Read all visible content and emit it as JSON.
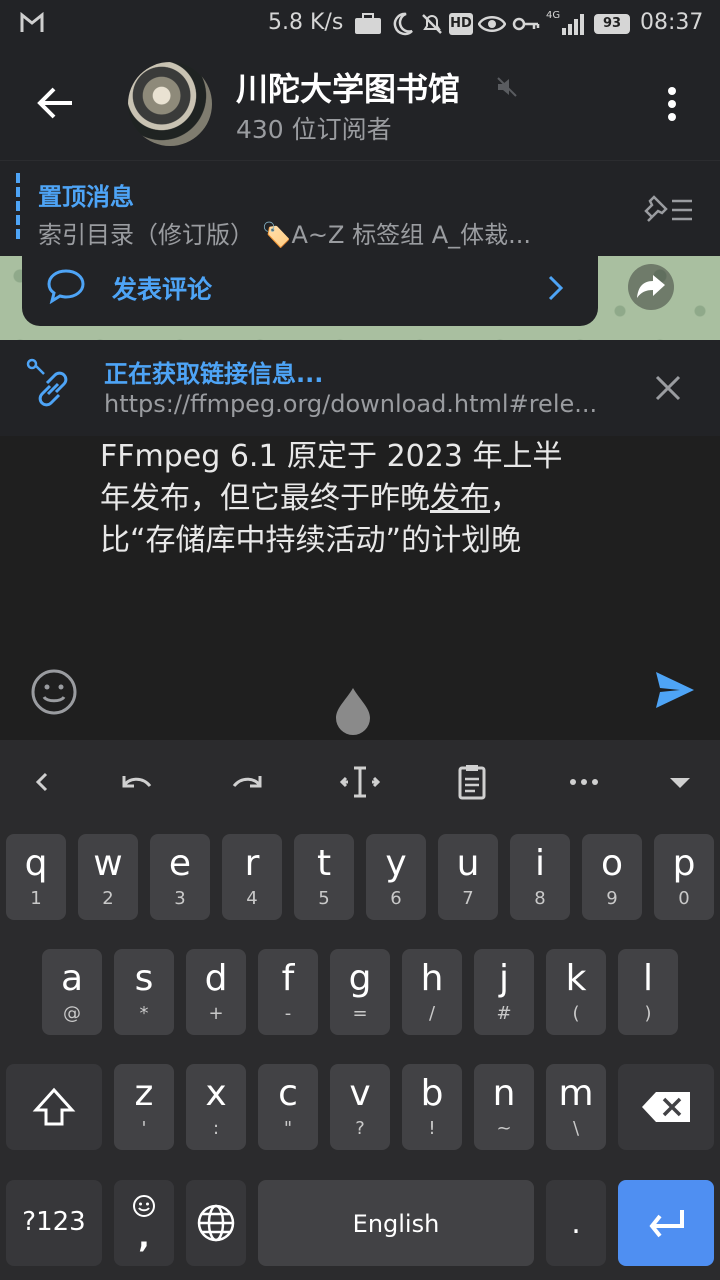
{
  "status_bar": {
    "network_speed": "5.8 K/s",
    "network_type": "4G",
    "battery": "93",
    "time": "08:37"
  },
  "header": {
    "title": "川陀大学图书馆",
    "subtitle": "430 位订阅者"
  },
  "pinned": {
    "title": "置顶消息",
    "text": "索引目录（修订版） 🏷️A~Z 标签组  A_体裁..."
  },
  "comment_bar": {
    "label": "发表评论"
  },
  "link_preview": {
    "title": "正在获取链接信息...",
    "url": "https://ffmpeg.org/download.html#rele..."
  },
  "composer": {
    "line1": "FFmpeg 6.1 原定于 2023 年上半",
    "line2_prefix": "年发布，但它最终于昨晚",
    "line2_link": "发布",
    "line2_suffix": "，",
    "line3": "比“存储库中持续活动”的计划晚"
  },
  "keyboard": {
    "row1": [
      {
        "k": "q",
        "s": "1"
      },
      {
        "k": "w",
        "s": "2"
      },
      {
        "k": "e",
        "s": "3"
      },
      {
        "k": "r",
        "s": "4"
      },
      {
        "k": "t",
        "s": "5"
      },
      {
        "k": "y",
        "s": "6"
      },
      {
        "k": "u",
        "s": "7"
      },
      {
        "k": "i",
        "s": "8"
      },
      {
        "k": "o",
        "s": "9"
      },
      {
        "k": "p",
        "s": "0"
      }
    ],
    "row2": [
      {
        "k": "a",
        "s": "@"
      },
      {
        "k": "s",
        "s": "*"
      },
      {
        "k": "d",
        "s": "+"
      },
      {
        "k": "f",
        "s": "-"
      },
      {
        "k": "g",
        "s": "="
      },
      {
        "k": "h",
        "s": "/"
      },
      {
        "k": "j",
        "s": "#"
      },
      {
        "k": "k",
        "s": "("
      },
      {
        "k": "l",
        "s": ")"
      }
    ],
    "row3": [
      {
        "k": "z",
        "s": "'"
      },
      {
        "k": "x",
        "s": ":"
      },
      {
        "k": "c",
        "s": "\""
      },
      {
        "k": "v",
        "s": "?"
      },
      {
        "k": "b",
        "s": "!"
      },
      {
        "k": "n",
        "s": "~"
      },
      {
        "k": "m",
        "s": "\\"
      }
    ],
    "symbols_label": "?123",
    "comma": ",",
    "space_label": "English",
    "period": "."
  }
}
